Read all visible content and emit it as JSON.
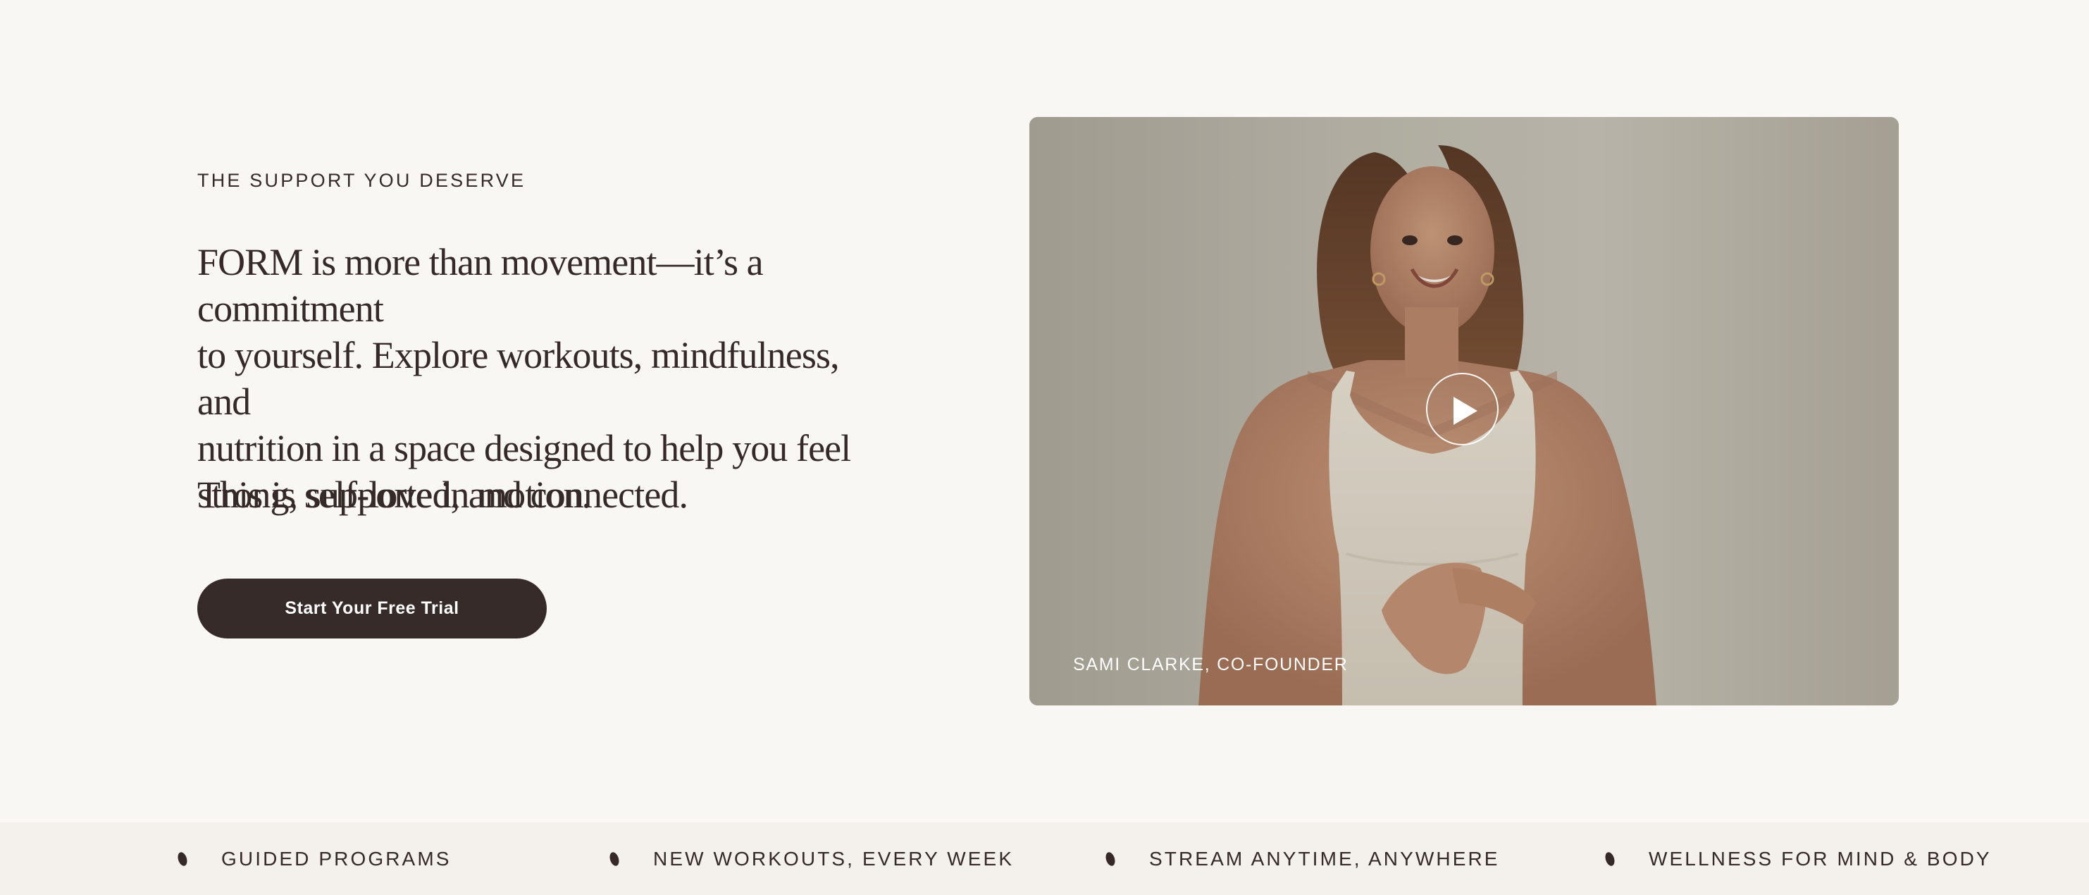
{
  "section": {
    "eyebrow": "THE SUPPORT YOU DESERVE",
    "body_lines": [
      "FORM is more than movement—it’s a commitment",
      "to yourself. Explore workouts, mindfulness, and",
      "nutrition in a space designed to help you feel",
      "strong, supported, and connected."
    ],
    "tagline": "This is self-love in motion.",
    "cta_label": "Start Your Free Trial"
  },
  "video": {
    "caption": "SAMI CLARKE, CO-FOUNDER",
    "play_icon": "play-icon"
  },
  "marquee": {
    "items": [
      {
        "label": "GUIDED PROGRAMS",
        "icon": "dot-icon"
      },
      {
        "label": "NEW WORKOUTS, EVERY WEEK",
        "icon": "dot-icon"
      },
      {
        "label": "STREAM ANYTIME, ANYWHERE",
        "icon": "dot-icon"
      },
      {
        "label": "WELLNESS FOR MIND & BODY",
        "icon": "dot-icon"
      }
    ]
  },
  "colors": {
    "background": "#f9f7f3",
    "text": "#352a28",
    "button": "#362b29",
    "button_text": "#ffffff",
    "marquee_background": "#f4f1ec"
  }
}
